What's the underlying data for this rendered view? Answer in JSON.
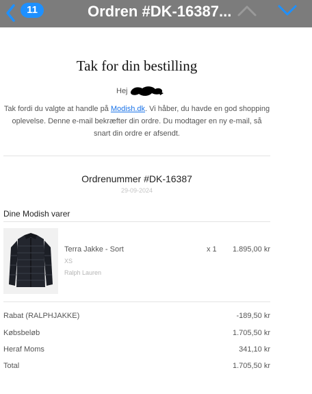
{
  "nav": {
    "unread_count": "11",
    "title": "Ordren #DK-16387..."
  },
  "email": {
    "title": "Tak for din bestilling",
    "greeting": "Hej",
    "intro_before_link": "Tak fordi du valgte at handle på ",
    "shop_link": "Modish.dk",
    "intro_after_link": ". Vi håber, du havde en god shopping oplevelse. Denne e-mail bekræfter din ordre. Du modtager en ny e-mail, så snart din ordre er afsendt.",
    "order_number": "Ordrenummer #DK-16387",
    "order_date": "29-09-2024",
    "items_heading": "Dine Modish varer",
    "item": {
      "name": "Terra Jakke - Sort",
      "size": "XS",
      "brand": "Ralph Lauren",
      "quantity": "x 1",
      "price": "1.895,00 kr"
    },
    "summary": [
      {
        "label": "Rabat (RALPHJAKKE)",
        "value": "-189,50 kr"
      },
      {
        "label": "Købsbeløb",
        "value": "1.705,50 kr"
      },
      {
        "label": "Heraf Moms",
        "value": "341,10 kr"
      },
      {
        "label": "Total",
        "value": "1.705,50 kr"
      }
    ]
  },
  "colors": {
    "navbar": "#7c7c7c",
    "badge": "#1e90ff",
    "link": "#1a73e8"
  },
  "icons": {
    "back": "chevron-left-icon",
    "previous": "chevron-up-icon",
    "next": "chevron-down-icon",
    "product": "black-puffer-jacket-image"
  }
}
